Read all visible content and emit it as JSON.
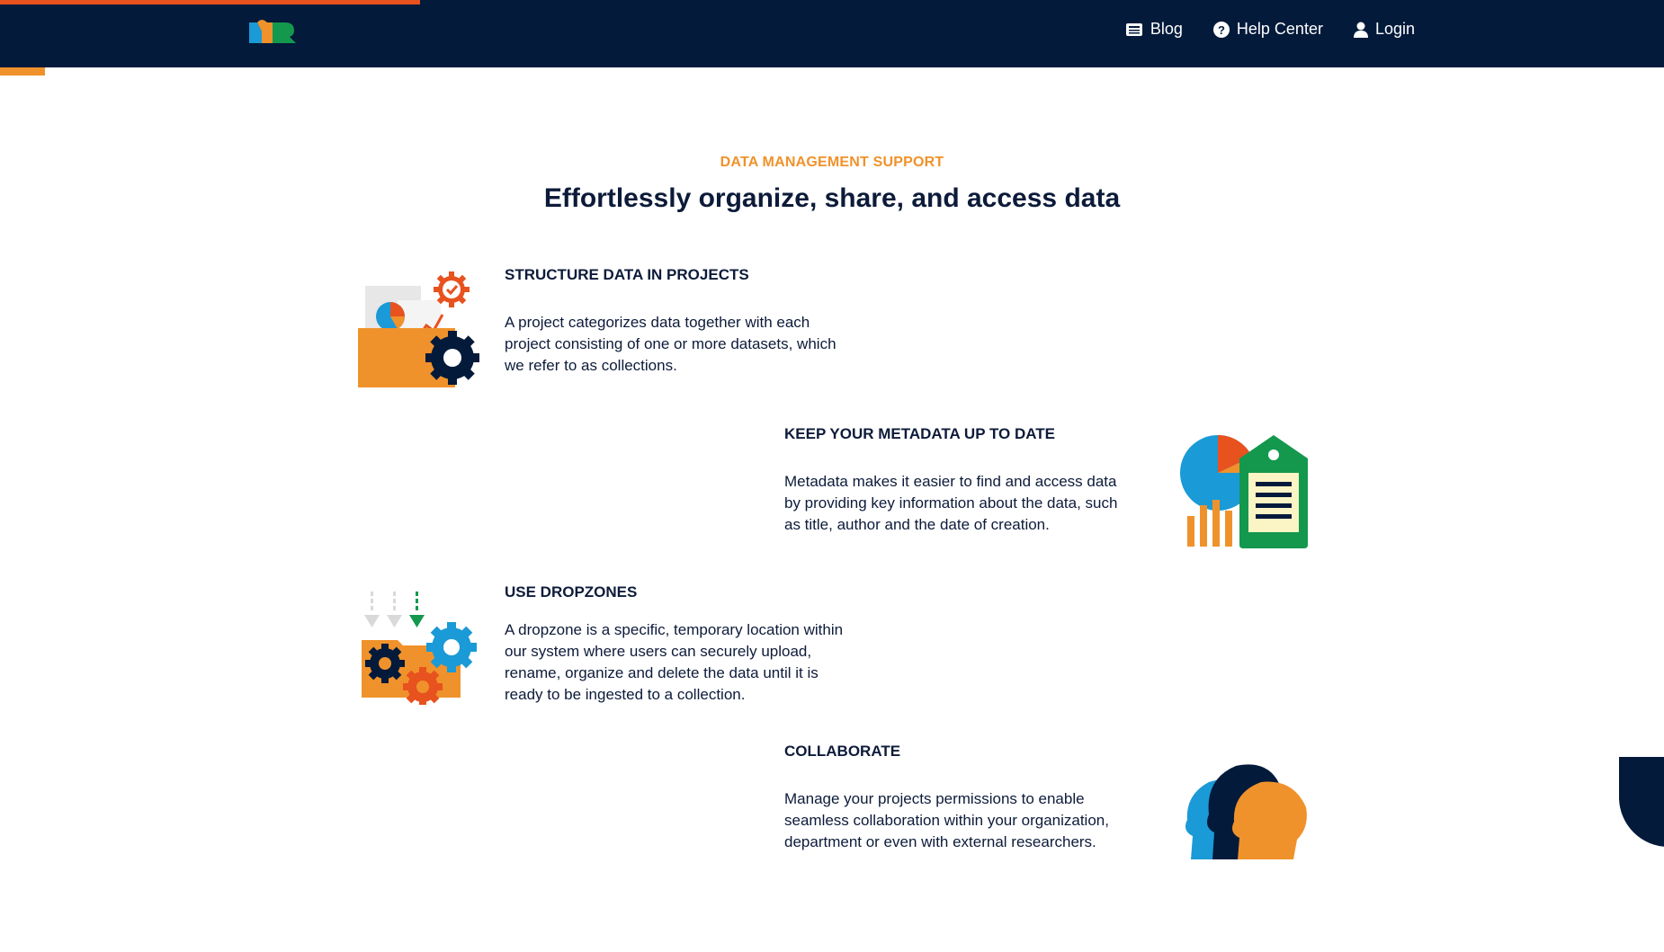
{
  "header": {
    "logo_name": "app-logo",
    "nav": [
      {
        "label": "Blog",
        "icon": "blog-icon"
      },
      {
        "label": "Help Center",
        "icon": "help-icon"
      },
      {
        "label": "Login",
        "icon": "user-icon"
      }
    ]
  },
  "hero": {
    "eyebrow": "DATA MANAGEMENT SUPPORT",
    "headline": "Effortlessly organize, share, and access data"
  },
  "features": [
    {
      "title": "STRUCTURE DATA IN PROJECTS",
      "lines": [
        "A project categorizes data together with each",
        "project consisting of one or more datasets, which",
        "we refer to as collections."
      ],
      "icon": "folder-charts-illustration"
    },
    {
      "title": "KEEP YOUR METADATA UP TO DATE",
      "lines": [
        "Metadata makes it easier to find and access data",
        "by providing key information about the data, such",
        "as title, author and the date of creation."
      ],
      "icon": "metadata-tag-illustration"
    },
    {
      "title": "USE DROPZONES",
      "lines": [
        "A dropzone is a specific, temporary location within",
        "our system where users can securely upload,",
        "rename, organize and delete the data until it is",
        "ready to be ingested to a collection."
      ],
      "icon": "dropzone-illustration"
    },
    {
      "title": "COLLABORATE",
      "lines": [
        "Manage your projects permissions to enable",
        "seamless collaboration within your organization,",
        "department or even with external researchers."
      ],
      "icon": "collaborate-heads-illustration"
    }
  ],
  "colors": {
    "navy": "#031a3a",
    "orange": "#f0922b",
    "red_orange": "#e8521e",
    "blue": "#1a9ad6",
    "green": "#14984e"
  }
}
